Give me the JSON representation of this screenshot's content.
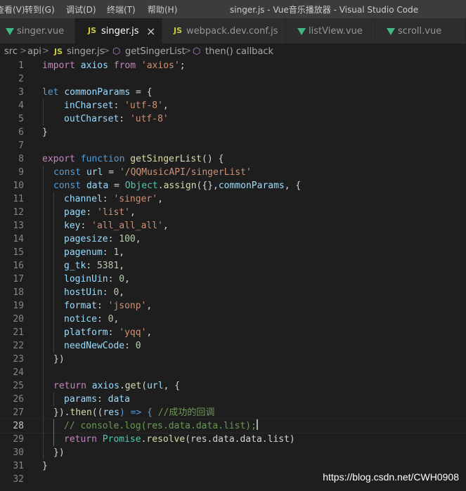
{
  "menu": [
    "查看(V)",
    "转到(G)",
    "调试(D)",
    "终端(T)",
    "帮助(H)"
  ],
  "window_title": "singer.js - Vue音乐播放器 - Visual Studio Code",
  "tabs": [
    {
      "label": "singer.vue",
      "icon": "vue-icon"
    },
    {
      "label": "singer.js",
      "icon": "js-icon",
      "icon_text": "JS",
      "active": true,
      "close": "×"
    },
    {
      "label": "webpack.dev.conf.js",
      "icon": "js-icon",
      "icon_text": "JS"
    },
    {
      "label": "listView.vue",
      "icon": "vue-icon"
    },
    {
      "label": "scroll.vue",
      "icon": "vue-icon"
    }
  ],
  "breadcrumb": {
    "src": "src",
    "api": "api",
    "js_badge": "JS",
    "file": "singer.js",
    "func": "getSingerList",
    "callback": "then() callback",
    "sep": ">"
  },
  "code": {
    "current_line": 28,
    "line_numbers": [
      "1",
      "2",
      "3",
      "4",
      "5",
      "6",
      "7",
      "8",
      "9",
      "10",
      "11",
      "12",
      "13",
      "14",
      "15",
      "16",
      "17",
      "18",
      "19",
      "20",
      "21",
      "22",
      "23",
      "24",
      "25",
      "26",
      "27",
      "28",
      "29",
      "30",
      "31",
      "32"
    ],
    "tokens": {
      "import": "import",
      "axios": "axios",
      "from": "from",
      "axios_str": "'axios'",
      "semi": ";",
      "let": "let",
      "commonParams": "commonParams",
      "eq_brace": " = {",
      "inCharset": "inCharset",
      "colon": ": ",
      "utf8": "'utf-8'",
      "comma": ",",
      "outCharset": "outCharset",
      "close_brace": "}",
      "export": "export",
      "function": "function",
      "getSingerList": "getSingerList",
      "fn_open": "() {",
      "const": "const",
      "url": "url",
      "eq": " = ",
      "url_str": "'/QQMusicAPI/singerList'",
      "data": "data",
      "Object": "Object",
      "dot": ".",
      "assign": "assign",
      "assign_args": "({},",
      "commonParams2": "commonParams",
      "assign_end": ", {",
      "channel": "channel",
      "singer_str": "'singer'",
      "page": "page",
      "list_str": "'list'",
      "key": "key",
      "allallall": "'all_all_all'",
      "pagesize": "pagesize",
      "n100": "100",
      "pagenum": "pagenum",
      "n1": "1",
      "g_tk": "g_tk",
      "n5381": "5381",
      "loginUin": "loginUin",
      "n0": "0",
      "hostUin": "hostUin",
      "format": "format",
      "jsonp_str": "'jsonp'",
      "notice": "notice",
      "platform": "platform",
      "yqq_str": "'yqq'",
      "needNewCode": "needNewCode",
      "close_paren": "})",
      "return": "return",
      "get": "get",
      "get_args_open": "(",
      "get_args_end": ", {",
      "params": "params",
      "then_prefix": "}).",
      "then": "then",
      "then_open": "((",
      "res": "res",
      "arrow_close": ") => { ",
      "comment_cn": "//成功的回调",
      "comment_log": "// console.log(res.data.data.list);",
      "Promise": "Promise",
      "resolve": "resolve",
      "resolve_args": "(res.data.data.list)",
      "close_paren2": "})",
      "close_brace2": "}"
    }
  },
  "watermark": "https://blog.csdn.net/CWH0908"
}
